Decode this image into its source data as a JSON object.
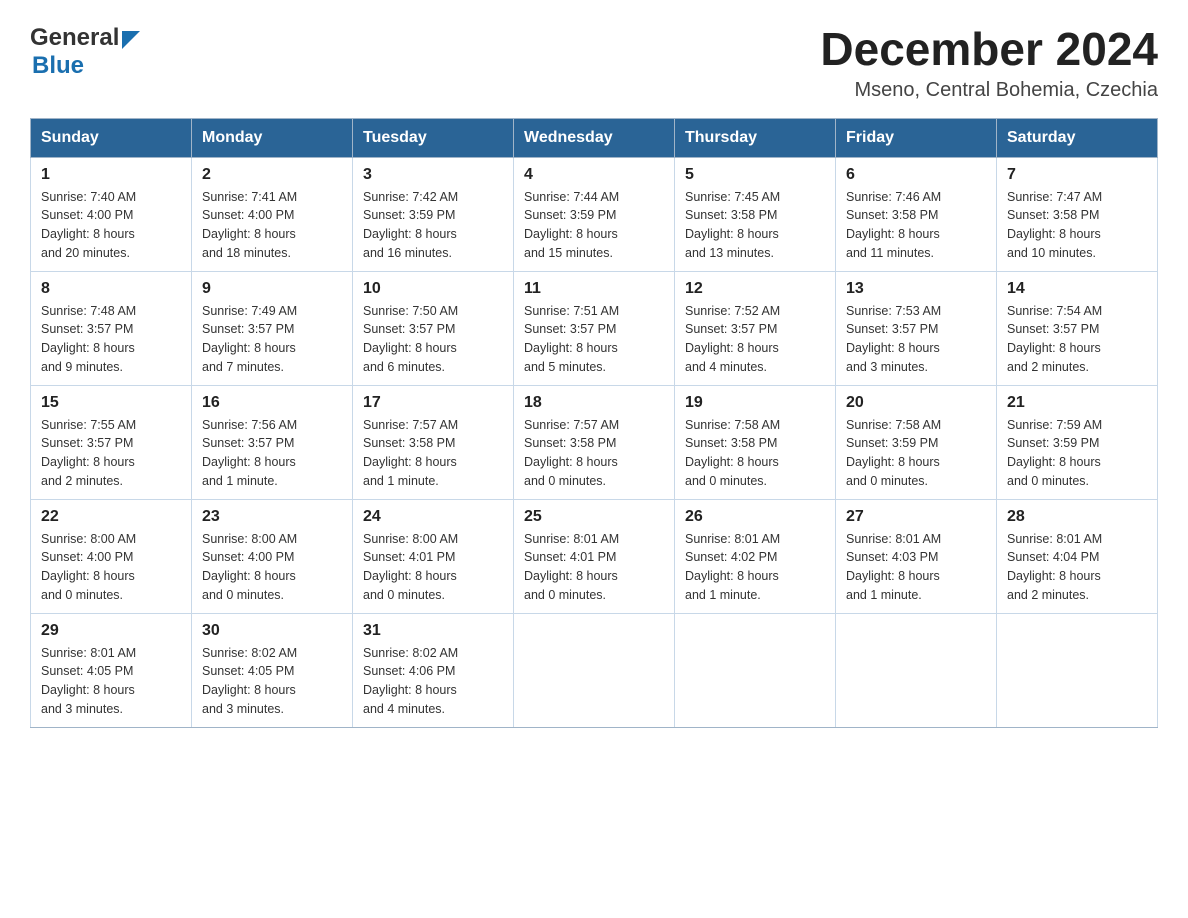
{
  "logo": {
    "general": "General",
    "blue": "Blue"
  },
  "title": "December 2024",
  "subtitle": "Mseno, Central Bohemia, Czechia",
  "days_of_week": [
    "Sunday",
    "Monday",
    "Tuesday",
    "Wednesday",
    "Thursday",
    "Friday",
    "Saturday"
  ],
  "weeks": [
    [
      {
        "day": "1",
        "sunrise": "7:40 AM",
        "sunset": "4:00 PM",
        "daylight": "8 hours and 20 minutes."
      },
      {
        "day": "2",
        "sunrise": "7:41 AM",
        "sunset": "4:00 PM",
        "daylight": "8 hours and 18 minutes."
      },
      {
        "day": "3",
        "sunrise": "7:42 AM",
        "sunset": "3:59 PM",
        "daylight": "8 hours and 16 minutes."
      },
      {
        "day": "4",
        "sunrise": "7:44 AM",
        "sunset": "3:59 PM",
        "daylight": "8 hours and 15 minutes."
      },
      {
        "day": "5",
        "sunrise": "7:45 AM",
        "sunset": "3:58 PM",
        "daylight": "8 hours and 13 minutes."
      },
      {
        "day": "6",
        "sunrise": "7:46 AM",
        "sunset": "3:58 PM",
        "daylight": "8 hours and 11 minutes."
      },
      {
        "day": "7",
        "sunrise": "7:47 AM",
        "sunset": "3:58 PM",
        "daylight": "8 hours and 10 minutes."
      }
    ],
    [
      {
        "day": "8",
        "sunrise": "7:48 AM",
        "sunset": "3:57 PM",
        "daylight": "8 hours and 9 minutes."
      },
      {
        "day": "9",
        "sunrise": "7:49 AM",
        "sunset": "3:57 PM",
        "daylight": "8 hours and 7 minutes."
      },
      {
        "day": "10",
        "sunrise": "7:50 AM",
        "sunset": "3:57 PM",
        "daylight": "8 hours and 6 minutes."
      },
      {
        "day": "11",
        "sunrise": "7:51 AM",
        "sunset": "3:57 PM",
        "daylight": "8 hours and 5 minutes."
      },
      {
        "day": "12",
        "sunrise": "7:52 AM",
        "sunset": "3:57 PM",
        "daylight": "8 hours and 4 minutes."
      },
      {
        "day": "13",
        "sunrise": "7:53 AM",
        "sunset": "3:57 PM",
        "daylight": "8 hours and 3 minutes."
      },
      {
        "day": "14",
        "sunrise": "7:54 AM",
        "sunset": "3:57 PM",
        "daylight": "8 hours and 2 minutes."
      }
    ],
    [
      {
        "day": "15",
        "sunrise": "7:55 AM",
        "sunset": "3:57 PM",
        "daylight": "8 hours and 2 minutes."
      },
      {
        "day": "16",
        "sunrise": "7:56 AM",
        "sunset": "3:57 PM",
        "daylight": "8 hours and 1 minute."
      },
      {
        "day": "17",
        "sunrise": "7:57 AM",
        "sunset": "3:58 PM",
        "daylight": "8 hours and 1 minute."
      },
      {
        "day": "18",
        "sunrise": "7:57 AM",
        "sunset": "3:58 PM",
        "daylight": "8 hours and 0 minutes."
      },
      {
        "day": "19",
        "sunrise": "7:58 AM",
        "sunset": "3:58 PM",
        "daylight": "8 hours and 0 minutes."
      },
      {
        "day": "20",
        "sunrise": "7:58 AM",
        "sunset": "3:59 PM",
        "daylight": "8 hours and 0 minutes."
      },
      {
        "day": "21",
        "sunrise": "7:59 AM",
        "sunset": "3:59 PM",
        "daylight": "8 hours and 0 minutes."
      }
    ],
    [
      {
        "day": "22",
        "sunrise": "8:00 AM",
        "sunset": "4:00 PM",
        "daylight": "8 hours and 0 minutes."
      },
      {
        "day": "23",
        "sunrise": "8:00 AM",
        "sunset": "4:00 PM",
        "daylight": "8 hours and 0 minutes."
      },
      {
        "day": "24",
        "sunrise": "8:00 AM",
        "sunset": "4:01 PM",
        "daylight": "8 hours and 0 minutes."
      },
      {
        "day": "25",
        "sunrise": "8:01 AM",
        "sunset": "4:01 PM",
        "daylight": "8 hours and 0 minutes."
      },
      {
        "day": "26",
        "sunrise": "8:01 AM",
        "sunset": "4:02 PM",
        "daylight": "8 hours and 1 minute."
      },
      {
        "day": "27",
        "sunrise": "8:01 AM",
        "sunset": "4:03 PM",
        "daylight": "8 hours and 1 minute."
      },
      {
        "day": "28",
        "sunrise": "8:01 AM",
        "sunset": "4:04 PM",
        "daylight": "8 hours and 2 minutes."
      }
    ],
    [
      {
        "day": "29",
        "sunrise": "8:01 AM",
        "sunset": "4:05 PM",
        "daylight": "8 hours and 3 minutes."
      },
      {
        "day": "30",
        "sunrise": "8:02 AM",
        "sunset": "4:05 PM",
        "daylight": "8 hours and 3 minutes."
      },
      {
        "day": "31",
        "sunrise": "8:02 AM",
        "sunset": "4:06 PM",
        "daylight": "8 hours and 4 minutes."
      },
      null,
      null,
      null,
      null
    ]
  ],
  "labels": {
    "sunrise": "Sunrise:",
    "sunset": "Sunset:",
    "daylight": "Daylight:"
  }
}
